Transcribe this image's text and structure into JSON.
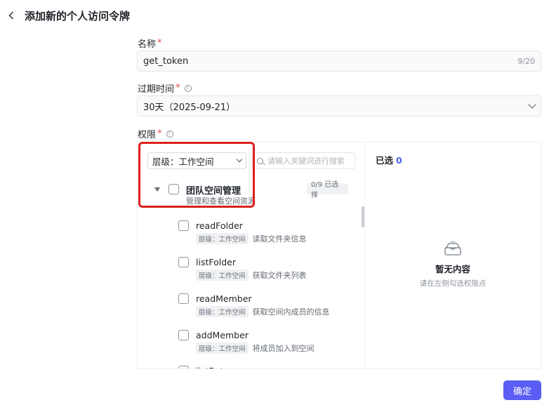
{
  "header": {
    "title": "添加新的个人访问令牌"
  },
  "name_field": {
    "label": "名称",
    "required": "*",
    "value": "get_token",
    "count": "9/20"
  },
  "expiry_field": {
    "label": "过期时间",
    "required": "*",
    "value": "30天（2025-09-21）"
  },
  "permissions": {
    "label": "权限",
    "required": "*",
    "level_select": "层级：工作空间",
    "search_placeholder": "请输入关键词进行搜索",
    "group": {
      "title": "团队空间管理",
      "description": "管理和查看空间资源",
      "badge": "0/9 已选择"
    },
    "items": [
      {
        "name": "readFolder",
        "tag": "层级：工作空间",
        "desc": "读取文件夹信息"
      },
      {
        "name": "listFolder",
        "tag": "层级：工作空间",
        "desc": "获取文件夹列表"
      },
      {
        "name": "readMember",
        "tag": "层级：工作空间",
        "desc": "获取空间内成员的信息"
      },
      {
        "name": "addMember",
        "tag": "层级：工作空间",
        "desc": "将成员加入到空间"
      },
      {
        "name": "listBot"
      }
    ],
    "selected": {
      "label": "已选",
      "count": "0"
    },
    "empty": {
      "title": "暂无内容",
      "desc": "请在左侧勾选权限点"
    }
  },
  "footer": {
    "confirm_label": "确定"
  },
  "colors": {
    "accent": "#5b5ef4",
    "required": "#e5484d",
    "highlight": "#e0201b",
    "count": "#4e5ee8"
  }
}
